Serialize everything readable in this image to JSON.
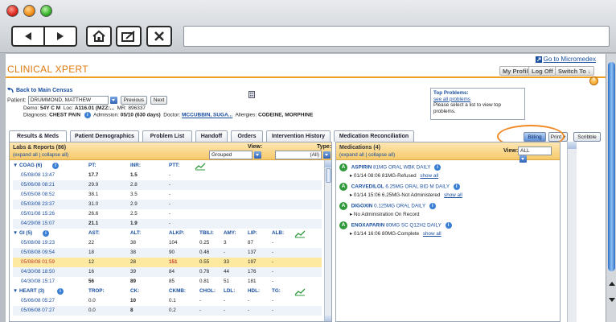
{
  "browser": {
    "back": "back-arrow",
    "forward": "forward-arrow",
    "home": "home-icon",
    "edit": "edit-icon",
    "stop": "close-icon"
  },
  "app": {
    "title": "CLINICAL XPERT",
    "go_micromedex": "Go to Micromedex",
    "my_profile": "My Profile",
    "log_off": "Log Off",
    "switch_to": "Switch To ↓"
  },
  "patient": {
    "back_link": "Back to Main Census",
    "patient_label": "Patient:",
    "name": "DRUMMOND, MATTHEW",
    "previous": "Previous",
    "next": "Next",
    "demo": "Demo:",
    "demo_value": "54Y C M",
    "loc_label": "Loc:",
    "loc_value": "A116.01 (MZZ:...",
    "mr_label": "MR:",
    "mr_value": "896337",
    "diagnosis_label": "Diagnosis:",
    "diagnosis_value": "CHEST PAIN",
    "admission_label": "Admission:",
    "admission_value": "05/10 (630 days)",
    "doctor_label": "Doctor:",
    "doctor_value": "MCCUBBIN, SUGA...",
    "allergies_label": "Allergies:",
    "allergies_value": "CODEINE, MORPHINE"
  },
  "top_problems": {
    "title": "Top Problems:",
    "link": "see all problems",
    "hint": "Please select a list to view top problems."
  },
  "tabs": [
    "Results & Meds",
    "Patient Demographics",
    "Problem List",
    "Handoff",
    "Orders",
    "Intervention History",
    "Medication Reconciliation"
  ],
  "actions": {
    "billing": "Billing",
    "print": "Print ▾",
    "scribble": "Scribble"
  },
  "labs": {
    "title": "Labs & Reports (86)",
    "expand": "(expand all | collapse all)",
    "view_label": "View:",
    "view_value": "Grouped",
    "type_label": "Type:",
    "type_value": "(All)",
    "coag": {
      "title": "COAG (6)",
      "h1": "PT:",
      "h2": "INR:",
      "h3": "PTT:",
      "rows": [
        [
          "05/08/08 13:47",
          "17.7",
          "1.5",
          "-"
        ],
        [
          "05/06/08 08:21",
          "29.9",
          "2.8",
          "-"
        ],
        [
          "05/05/08 08:52",
          "38.1",
          "3.5",
          "-"
        ],
        [
          "05/03/08 23:37",
          "31.0",
          "2.9",
          "-"
        ],
        [
          "05/01/08 15:26",
          "26.6",
          "2.5",
          "-"
        ],
        [
          "04/29/08 15:07",
          "21.1",
          "1.9",
          "-"
        ]
      ]
    },
    "gi": {
      "title": "GI (5)",
      "h": [
        "AST:",
        "ALT:",
        "ALKP:",
        "TBILI:",
        "AMY:",
        "LIP:",
        "ALB:"
      ],
      "rows": [
        [
          "05/08/08 19:23",
          "22",
          "38",
          "104",
          "0.25",
          "3",
          "87",
          "-"
        ],
        [
          "05/08/08 09:54",
          "18",
          "38",
          "90",
          "0.46",
          "-",
          "137",
          "-"
        ],
        [
          "05/08/08 01:59",
          "12",
          "28",
          "151",
          "0.55",
          "33",
          "197",
          "-"
        ],
        [
          "04/30/08 18:50",
          "16",
          "39",
          "84",
          "0.76",
          "44",
          "176",
          "-"
        ],
        [
          "04/30/08 15:17",
          "56",
          "89",
          "85",
          "0.81",
          "51",
          "181",
          "-"
        ]
      ]
    },
    "heart": {
      "title": "HEART (3)",
      "h": [
        "TROP:",
        "CK:",
        "CKMB:",
        "CHOL:",
        "LDL:",
        "HDL:",
        "TG:"
      ],
      "rows": [
        [
          "05/06/08 05:27",
          "0.0",
          "10",
          "0.1",
          "-",
          "-",
          "-",
          "-"
        ],
        [
          "05/06/08 07:27",
          "0.0",
          "8",
          "0.2",
          "-",
          "-",
          "-",
          "-"
        ]
      ]
    }
  },
  "meds": {
    "title": "Medications (4)",
    "expand": "(expand all | collapse all)",
    "view_label": "View:",
    "view_value": "ALL",
    "items": [
      {
        "name": "ASPIRIN",
        "sig": "81MG ORAL WBK DAILY",
        "detail": "01/14 08:06 81MG-Refused",
        "link": "show all"
      },
      {
        "name": "CARVEDILOL",
        "sig": "6.25MG ORAL BID M DAILY",
        "detail": "01/14 15:06 6.25MG-Not Administered",
        "link": "show all"
      },
      {
        "name": "DIGOXIN",
        "sig": "0.125MG ORAL DAILY",
        "detail": "No Administration On Record",
        "link": ""
      },
      {
        "name": "ENOXAPARIN",
        "sig": "80MG SC Q12H2 DAILY",
        "detail": "01/14 16:06 80MG-Complete",
        "link": "show all"
      }
    ]
  }
}
